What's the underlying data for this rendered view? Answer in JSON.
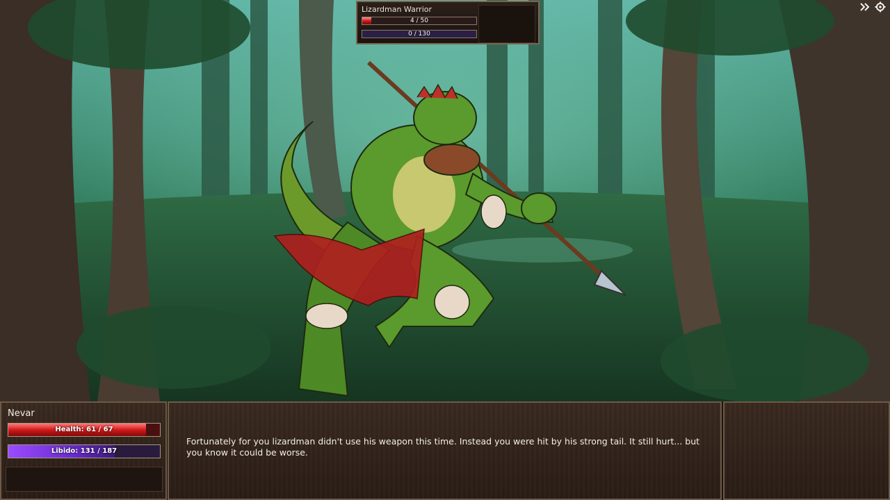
{
  "enemy": {
    "name": "Lizardman Warrior",
    "health_text": "4 / 50",
    "health_fraction": 0.08,
    "libido_text": "0 / 130",
    "libido_fraction": 0.0
  },
  "player": {
    "name": "Nevar",
    "health_text": "Health: 61 / 67",
    "health_fraction": 0.91,
    "libido_text": "Libido: 131 / 187",
    "libido_fraction": 0.7
  },
  "combat_log": {
    "text": "Fortunately for you lizardman didn't use his weapon this time. Instead you were hit by his strong tail. It still hurt... but you know it could be worse."
  },
  "icons": {
    "skip": "fast-forward-icon",
    "settings": "gear-icon"
  },
  "colors": {
    "health": "#d11a1a",
    "libido": "#6a2bd1",
    "panel_border": "#6d5a48"
  }
}
